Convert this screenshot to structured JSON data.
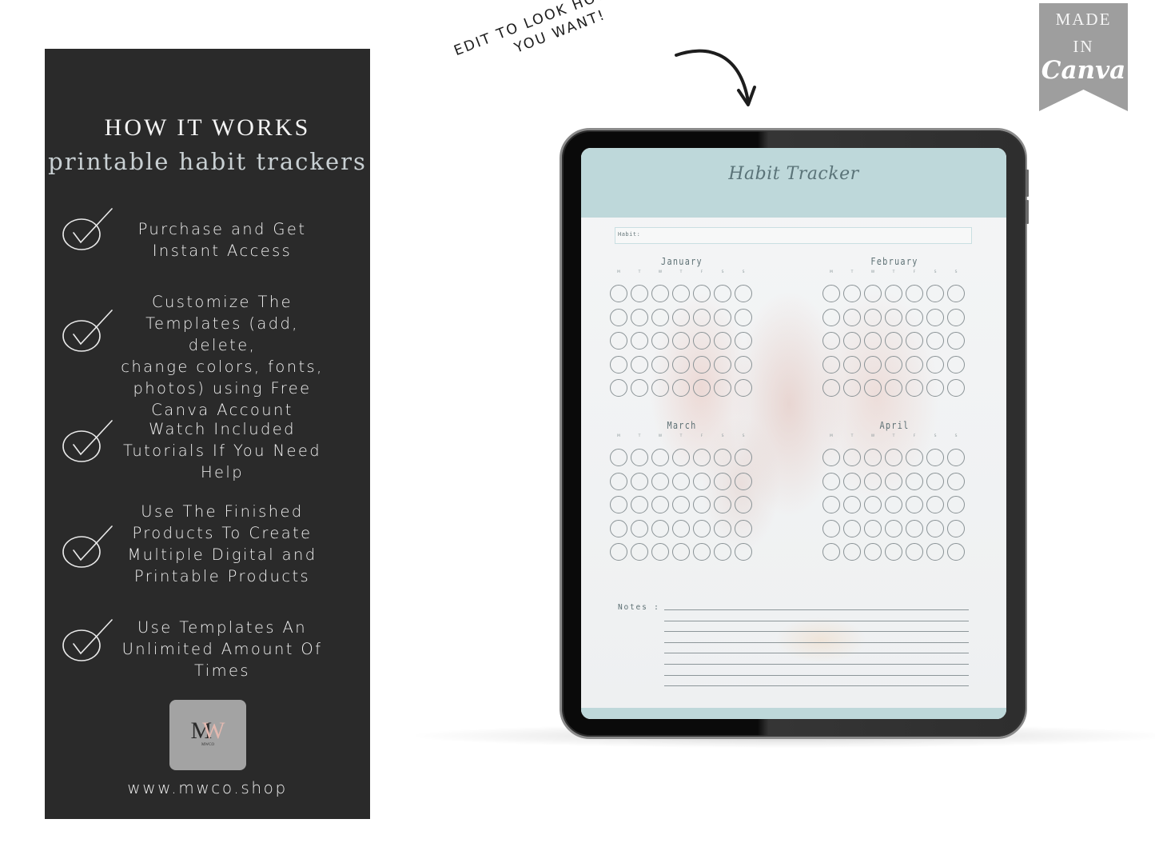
{
  "panel": {
    "title": "HOW IT WORKS",
    "subtitle": "printable habit trackers",
    "steps": [
      {
        "icon": "check-circle-icon",
        "lines": [
          "Purchase and Get",
          "Instant Access"
        ]
      },
      {
        "icon": "check-circle-icon",
        "lines": [
          "Customize The",
          "Templates (add, delete,",
          "change colors, fonts,",
          "photos) using Free",
          "Canva Account"
        ]
      },
      {
        "icon": "check-circle-icon",
        "lines": [
          "Watch Included",
          "Tutorials If You Need",
          "Help"
        ]
      },
      {
        "icon": "check-circle-icon",
        "lines": [
          "Use The Finished",
          "Products To Create",
          "Multiple Digital and",
          "Printable Products"
        ]
      },
      {
        "icon": "check-circle-icon",
        "lines": [
          "Use Templates An",
          "Unlimited Amount Of",
          "Times"
        ]
      }
    ],
    "logo": {
      "mark_m": "M",
      "mark_w": "W",
      "small": "MWCO"
    },
    "url": "www.mwco.shop"
  },
  "callout": {
    "line1": "EDIT TO LOOK HOWEVER",
    "line2": "YOU WANT!",
    "arrow": "curved-arrow-down-icon"
  },
  "badge": {
    "made": "MADE",
    "in": "IN",
    "brand": "Canva"
  },
  "tracker": {
    "title": "Habit Tracker",
    "habit_label": "Habit:",
    "weekdays": [
      "M",
      "T",
      "W",
      "T",
      "F",
      "S",
      "S"
    ],
    "rows_per_month": 5,
    "months": [
      {
        "name": "January"
      },
      {
        "name": "February"
      },
      {
        "name": "March"
      },
      {
        "name": "April"
      }
    ],
    "notes_label": "Notes :",
    "note_lines": 8
  },
  "colors": {
    "panel_bg": "#2a2a2a",
    "header_teal": "#bed8da",
    "badge_gray": "#9e9e9e",
    "logo_pink": "#e3b9b0"
  }
}
